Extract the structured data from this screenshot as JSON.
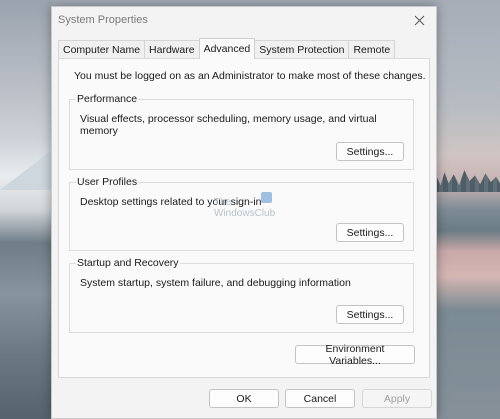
{
  "window": {
    "title": "System Properties"
  },
  "tabs": [
    {
      "label": "Computer Name",
      "active": false
    },
    {
      "label": "Hardware",
      "active": false
    },
    {
      "label": "Advanced",
      "active": true
    },
    {
      "label": "System Protection",
      "active": false
    },
    {
      "label": "Remote",
      "active": false
    }
  ],
  "panel": {
    "notice": "You must be logged on as an Administrator to make most of these changes."
  },
  "groups": {
    "performance": {
      "title": "Performance",
      "description": "Visual effects, processor scheduling, memory usage, and virtual memory",
      "button": "Settings..."
    },
    "user_profiles": {
      "title": "User Profiles",
      "description": "Desktop settings related to your sign-in",
      "button": "Settings..."
    },
    "startup_recovery": {
      "title": "Startup and Recovery",
      "description": "System startup, system failure, and debugging information",
      "button": "Settings..."
    }
  },
  "environment_button": "Environment Variables...",
  "footer": {
    "ok": "OK",
    "cancel": "Cancel",
    "apply": "Apply"
  },
  "watermark": {
    "line1": "The",
    "line2": "WindowsClub"
  },
  "icons": {
    "close": "close-icon"
  },
  "colors": {
    "dialog_bg": "#f3f3f3",
    "panel_bg": "#fafafa",
    "disabled_text": "#a0a0a0"
  }
}
